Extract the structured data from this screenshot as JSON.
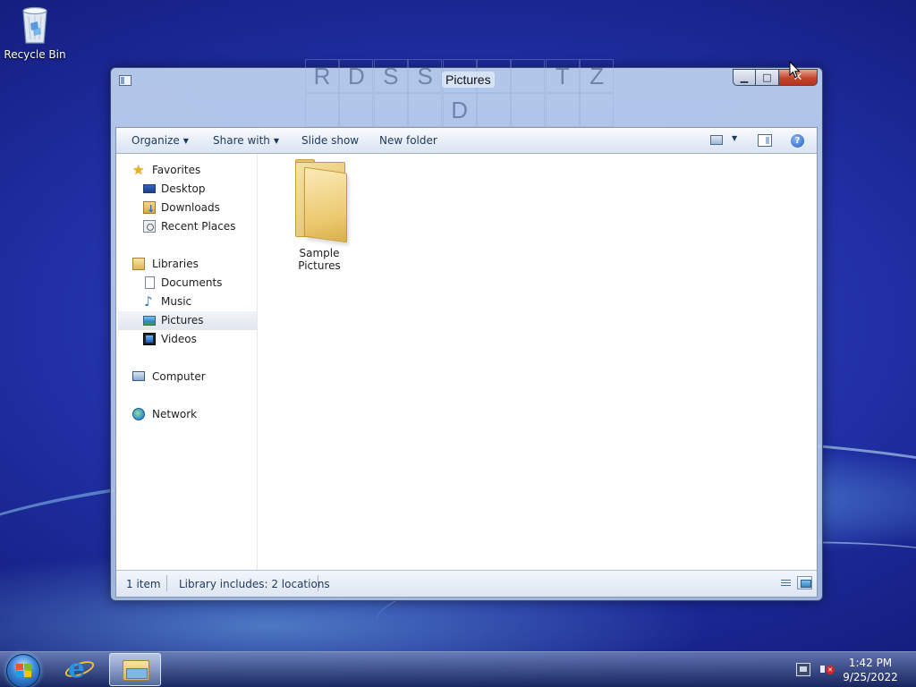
{
  "desktop": {
    "recycle_bin_label": "Recycle Bin"
  },
  "window": {
    "title": "Pictures",
    "ghost_letters_row1": [
      "R",
      "D",
      "S",
      "S",
      "",
      "",
      "",
      "T",
      "Z"
    ],
    "ghost_letters_row2": [
      "",
      "",
      "",
      "",
      "D",
      "",
      "",
      "",
      ""
    ]
  },
  "toolbar": {
    "organize_label": "Organize",
    "share_with_label": "Share with",
    "slide_show_label": "Slide show",
    "new_folder_label": "New folder"
  },
  "nav": {
    "favorites_label": "Favorites",
    "favorites_items": [
      "Desktop",
      "Downloads",
      "Recent Places"
    ],
    "libraries_label": "Libraries",
    "libraries_items": [
      "Documents",
      "Music",
      "Pictures",
      "Videos"
    ],
    "selected": "Pictures",
    "computer_label": "Computer",
    "network_label": "Network"
  },
  "content": {
    "items": [
      {
        "name": "Sample Pictures",
        "type": "folder"
      }
    ]
  },
  "statusbar": {
    "item_count": "1 item",
    "library_info": "Library includes: 2 locations"
  },
  "taskbar": {
    "time": "1:42 PM",
    "date": "9/25/2022"
  },
  "icons": {
    "start": "windows-flag-icon",
    "ie": "internet-explorer-icon",
    "explorer": "folder-icon",
    "tray_network": "network-icon",
    "tray_volume": "volume-muted-icon"
  }
}
